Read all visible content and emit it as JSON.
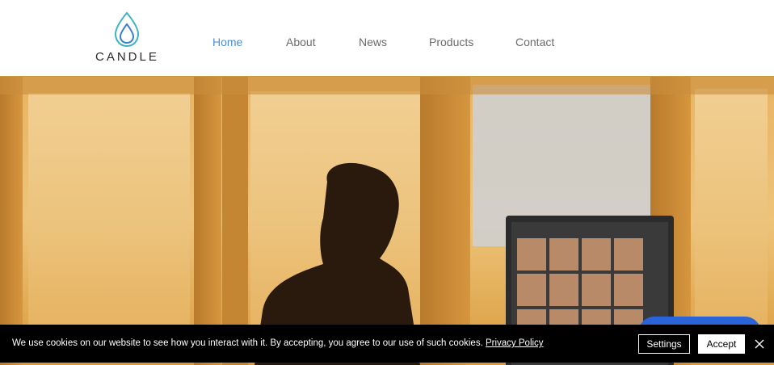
{
  "brand": {
    "name": "CANDLE",
    "logo_icon": "candle-flame-icon",
    "logo_colors": [
      "#3bb3c4",
      "#3a7bd5"
    ]
  },
  "nav": {
    "items": [
      {
        "label": "Home",
        "active": true
      },
      {
        "label": "About",
        "active": false
      },
      {
        "label": "News",
        "active": false
      },
      {
        "label": "Products",
        "active": false
      },
      {
        "label": "Contact",
        "active": false
      }
    ],
    "active_color": "#4f8fd1",
    "color": "#6b6b6b"
  },
  "hero": {
    "image": "person-on-video-call-photo",
    "tone": "#e0a848"
  },
  "chat": {
    "icon": "chat-widget-button",
    "color": "#2b63d9"
  },
  "cookie_banner": {
    "text": "We use cookies on our website to see how you interact with it. By accepting, you agree to our use of such cookies.",
    "privacy_link": "Privacy Policy",
    "settings_label": "Settings",
    "accept_label": "Accept",
    "close_icon": "close-icon"
  }
}
